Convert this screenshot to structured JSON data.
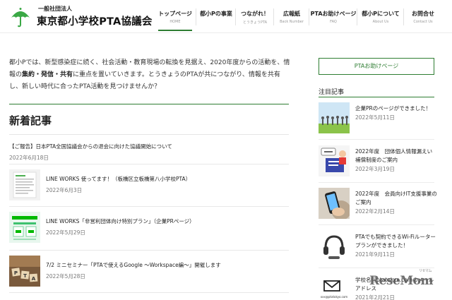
{
  "header": {
    "logo_small": "一般社団法人",
    "logo_big": "東京都小学校PTA協議会",
    "nav": [
      {
        "label": "トップページ",
        "sub": "HOME",
        "active": true
      },
      {
        "label": "都小Pの事業",
        "sub": "",
        "active": false
      },
      {
        "label": "つながれ！",
        "sub": "とうきょうPTA",
        "active": false
      },
      {
        "label": "広報紙",
        "sub": "Back Number",
        "active": false
      },
      {
        "label": "PTAお助けページ",
        "sub": "FAQ",
        "active": false
      },
      {
        "label": "都小Pについて",
        "sub": "About Us",
        "active": false
      },
      {
        "label": "お問合せ",
        "sub": "Contact Us",
        "active": false
      }
    ]
  },
  "intro": {
    "part1": "都小Pでは、新型感染症に続く、社会活動・教育現場の転換を見据え、2020年度からの活動を、情報の",
    "bold": "集約・発信・共有",
    "part2": "に重点を置いていきます。とうきょうのPTAが共につながり、情報を共有し、新しい時代に合ったPTA活動を見つけませんか？"
  },
  "main": {
    "section_title": "新着記事",
    "articles": [
      {
        "title": "【ご報告】日本PTA全国協議会からの退会に向けた協議開始について",
        "date": "2022年6月18日",
        "thumb": "none"
      },
      {
        "title": "LINE WORKS 使ってます！（板橋区立板橋第八小学校PTA）",
        "date": "2022年6月3日",
        "thumb": "doc-thumb"
      },
      {
        "title": "LINE WORKS「非営利団体向け特別プラン」（企業PRページ）",
        "date": "2022年5月29日",
        "thumb": "lineworks-thumb"
      },
      {
        "title": "7/2 ミニセミナー「PTAで使えるGoogle ～Workspace編～」開催します",
        "date": "2022年5月28日",
        "thumb": "pta-blocks-thumb"
      }
    ]
  },
  "sidebar": {
    "button_label": "PTAお助けページ",
    "title": "注目記事",
    "items": [
      {
        "title": "企業PRのページができました！",
        "date": "2022年5月11日",
        "thumb": "people-thumb"
      },
      {
        "title": "2022年度　団体個人情報漏えい補償制度のご案内",
        "date": "2022年3月19日",
        "thumb": "info-thumb"
      },
      {
        "title": "2022年度　会員向けIT支援事業のご案内",
        "date": "2022年2月14日",
        "thumb": "phone-thumb"
      },
      {
        "title": "PTAでも契約できるWi-Fiルータープランができました！",
        "date": "2021年9月11日",
        "thumb": "router-thumb"
      },
      {
        "title": "学校名＠ptatokyo.comのメールアドレス",
        "date": "2021年2月21日",
        "thumb": "mail-thumb",
        "thumb_text": "xxx@ptatokyo.com"
      }
    ]
  },
  "watermark": {
    "text": "ReseMom",
    "ruby": "リセマム"
  },
  "colors": {
    "accent": "#2e7d32",
    "text": "#333333",
    "muted": "#777777"
  }
}
